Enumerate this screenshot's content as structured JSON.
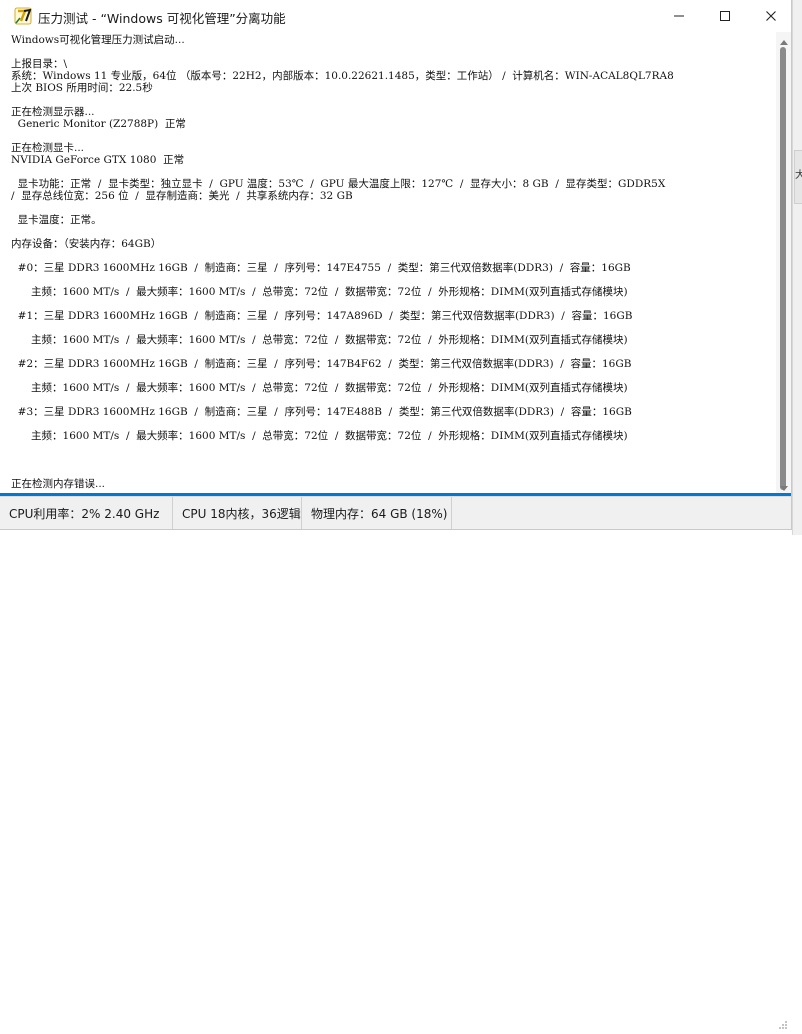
{
  "window": {
    "title": "压力测试 - “Windows 可视化管理”分离功能",
    "side_tab_label": "大"
  },
  "console": {
    "lines": [
      "Windows可视化管理压力测试启动...",
      "",
      "上报目录：\\",
      "系统：Windows 11 专业版，64位 （版本号：22H2，内部版本：10.0.22621.1485，类型：工作站） /  计算机名：WIN-ACAL8QL7RA8",
      "上次 BIOS 所用时间：22.5秒",
      "",
      "正在检测显示器...",
      "  Generic Monitor (Z2788P)  正常",
      "",
      "正在检测显卡...",
      "NVIDIA GeForce GTX 1080  正常",
      "",
      "  显卡功能：正常  /  显卡类型：独立显卡  /  GPU 温度：53℃  /  GPU 最大温度上限：127℃  /  显存大小：8 GB  /  显存类型：GDDR5X",
      "/  显存总线位宽：256 位  /  显存制造商：美光  /  共享系统内存：32 GB",
      "",
      "  显卡温度：正常。",
      "",
      "内存设备：（安装内存：64GB）",
      "",
      "  #0：三星 DDR3 1600MHz 16GB  /  制造商：三星  /  序列号：147E4755  /  类型：第三代双倍数据率(DDR3)  /  容量：16GB",
      "",
      "      主频：1600 MT/s  /  最大频率：1600 MT/s  /  总带宽：72位  /  数据带宽：72位  /  外形规格：DIMM(双列直插式存储模块)",
      "",
      "  #1：三星 DDR3 1600MHz 16GB  /  制造商：三星  /  序列号：147A896D  /  类型：第三代双倍数据率(DDR3)  /  容量：16GB",
      "",
      "      主频：1600 MT/s  /  最大频率：1600 MT/s  /  总带宽：72位  /  数据带宽：72位  /  外形规格：DIMM(双列直插式存储模块)",
      "",
      "  #2：三星 DDR3 1600MHz 16GB  /  制造商：三星  /  序列号：147B4F62  /  类型：第三代双倍数据率(DDR3)  /  容量：16GB",
      "",
      "      主频：1600 MT/s  /  最大频率：1600 MT/s  /  总带宽：72位  /  数据带宽：72位  /  外形规格：DIMM(双列直插式存储模块)",
      "",
      "  #3：三星 DDR3 1600MHz 16GB  /  制造商：三星  /  序列号：147E488B  /  类型：第三代双倍数据率(DDR3)  /  容量：16GB",
      "",
      "      主频：1600 MT/s  /  最大频率：1600 MT/s  /  总带宽：72位  /  数据带宽：72位  /  外形规格：DIMM(双列直插式存储模块)",
      "",
      "",
      "",
      "正在检测内存错误..."
    ]
  },
  "progress": {
    "fraction": 1.0
  },
  "status": {
    "cpu_usage": "CPU利用率：2%  2.40 GHz",
    "cpu_cores": "CPU 18内核，36逻辑",
    "memory": "物理内存：64 GB (18%)",
    "extra": ""
  },
  "colors": {
    "accent": "#0078d4",
    "statusbar_bg": "#f0f0f0",
    "scroll_thumb": "#8a8a8a"
  },
  "icons": {
    "app": "app-logo-icon",
    "minimize": "minimize-icon",
    "maximize": "maximize-icon",
    "close": "close-icon"
  }
}
